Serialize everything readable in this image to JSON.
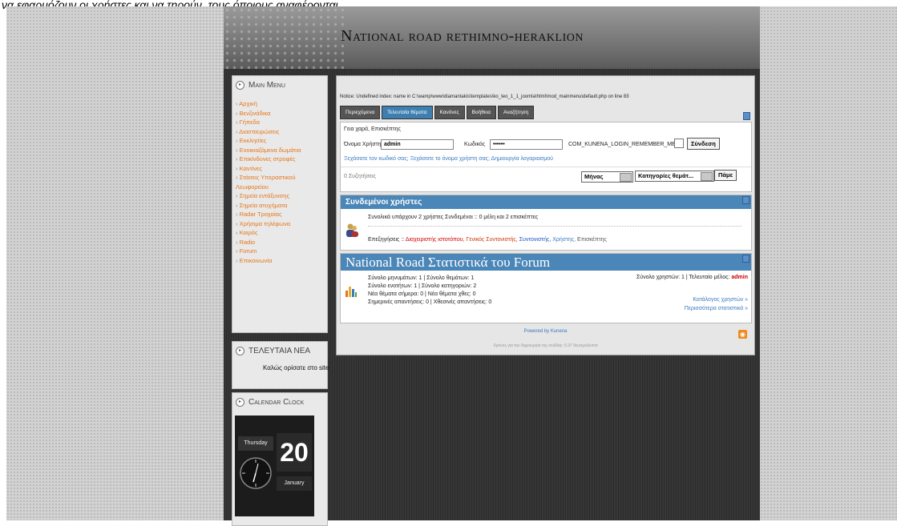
{
  "top_text": "να εφαρμόζουν οι χρήστες και να τηρούν, τους όποιους αναφέρονται.",
  "site_title": "National road rethimno-heraklion",
  "main_menu": {
    "title": "Main Menu",
    "items": [
      "Αρχική",
      "Βενζινάδικα",
      "Γήπεδα",
      "Διασταυρώσεις",
      "Εκκλησίες",
      "Ενοικιαζόμενα δωμάτια",
      "Επικίνδυνες στροφές",
      "Καντίνες",
      "Στάσεις Υπεραστικού Λεωφορείου",
      "Σημεία εντάξυνσης",
      "Σημεία ατυχήματα",
      "Radar Τροχαίας",
      "Χρήσιμα τηλέφωνα",
      "Καιρός",
      "Radio",
      "Forum",
      "Επικοινωνία"
    ]
  },
  "news": {
    "title": "ΤΕΛΕΥΤΑΙΑ ΝΕΑ",
    "text": "Καλώς ορίσατε στο site"
  },
  "calendar": {
    "title": "Calendar Clock",
    "weekday": "Thursday",
    "day": "20",
    "month": "January"
  },
  "forum": {
    "notice": "Notice: Undefined index: name in C:\\wamp\\www\\diamantakis\\templates\\ko_teo_1_1_joomla\\html\\mod_mainmenu\\default.php on line 83",
    "tabs": [
      "Περιεχόμενα",
      "Τελευταία θέματα",
      "Κανόνες",
      "Βοήθεια",
      "Αναζήτηση"
    ],
    "active_tab": "Τελευταία θέματα",
    "greeting": "Γεια χαρά, Επισκέπτης",
    "username_label": "Όνομα Χρήστη",
    "username_value": "admin",
    "password_label": "Κωδικός",
    "password_value": "••••••",
    "remember_label": "COM_KUNENA_LOGIN_REMEMBER_ME",
    "login_button": "Σύνδεση",
    "forgot_links": "Ξεχάσατε τον κωδικό σας; Ξεχάσατε το όνομα χρήστη σας; Δημιουργία λογαριασμού",
    "discussions": "0 Συζητήσεις",
    "month_select": "Μήνας",
    "category_select": "Κατηγορίες θεμάτ...",
    "go_button": "Πάμε",
    "online_title": "Συνδεμένοι χρήστες",
    "online_summary": "Συνολικά υπάρχουν 2 χρήστες Συνδεμένοι :: 0 μέλη και 2 επισκέπτες",
    "legend_label": "Επεξηγήσεις ::",
    "legend_items": [
      "Διαχειριστής ιστοτόπου,",
      "Γενικός Συντονιστής,",
      "Συντονιστής,",
      "Χρήστης,",
      "Επισκέπτης"
    ],
    "stats_title": "National Road Στατιστικά του Forum",
    "stats_lines": [
      "Σύνολο μηνυμάτων: 1 | Σύνολο θεμάτων: 1",
      "Σύνολο ενοτήτων: 1 | Σύνολο κατηγοριών: 2",
      "Νέα θέματα σήμερα: 0 | Νέα θέματα χθες: 0",
      "Σημερινές απαντήσεις: 0 | Χθεσινές απαντήσεις: 0"
    ],
    "stats_users": "Σύνολο χρηστών: 1 | Τελευταίο μέλος:",
    "stats_last_member": "admin",
    "users_list_link": "Κατάλογος χρηστών »",
    "more_stats_link": "Περισσότερα στατιστικά »",
    "powered": "Powered by Kunena",
    "gen_time": "Χρόνος για την δημιουργία της σελίδας: 0.37 δευτερόλεπτα"
  },
  "colors": {
    "accent_orange": "#e4761b",
    "bar_blue": "#4a86b8",
    "admin_red": "#cc0000"
  }
}
